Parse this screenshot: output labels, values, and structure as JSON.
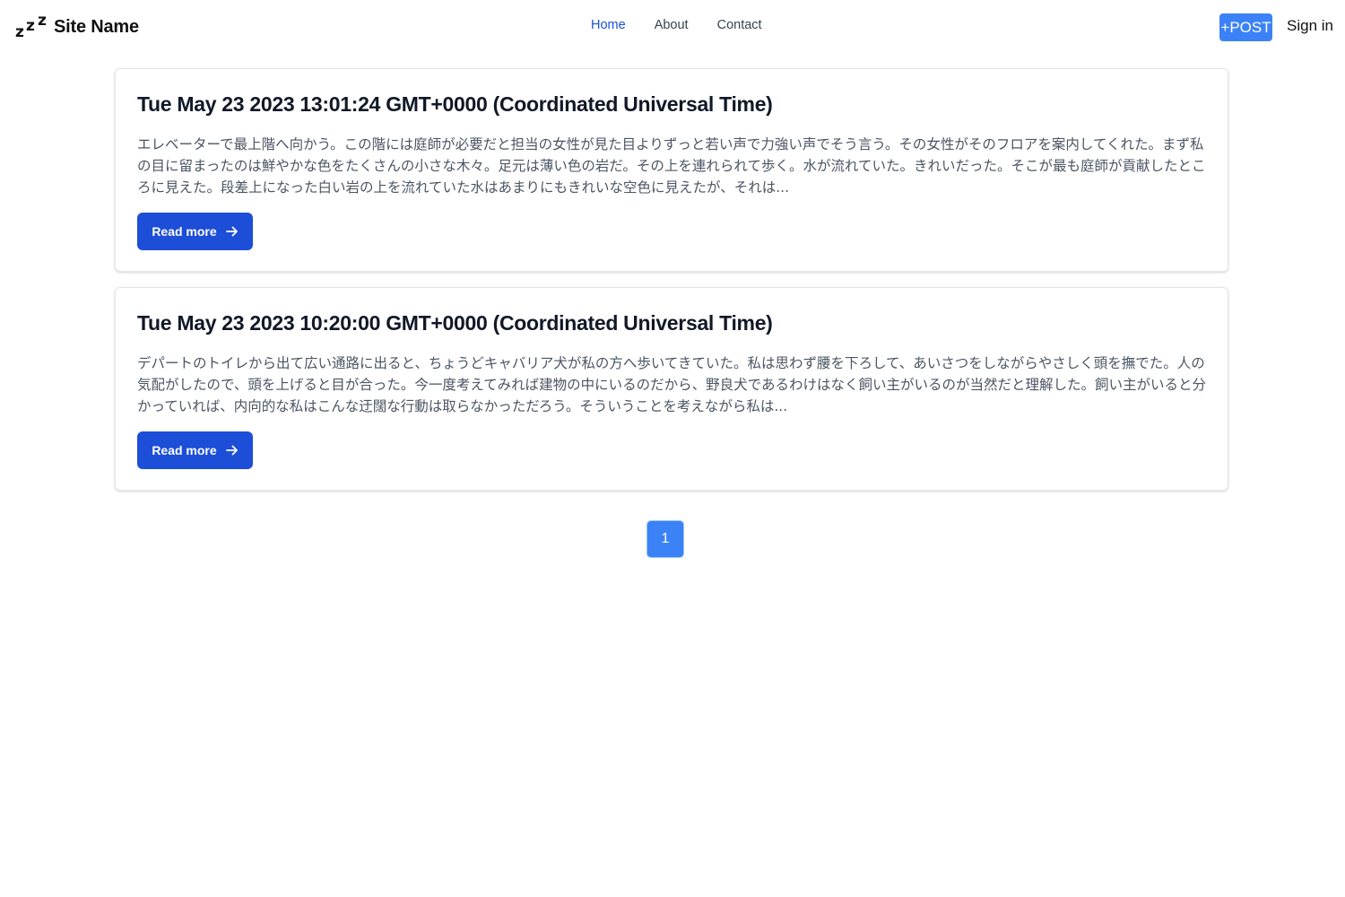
{
  "header": {
    "brand_name": "Site Name",
    "logo_letters": [
      "z",
      "z",
      "z"
    ],
    "nav": [
      {
        "label": "Home",
        "active": true
      },
      {
        "label": "About",
        "active": false
      },
      {
        "label": "Contact",
        "active": false
      }
    ],
    "post_label": "+POST",
    "signin_label": "Sign in"
  },
  "posts": [
    {
      "title": "Tue May 23 2023 13:01:24 GMT+0000 (Coordinated Universal Time)",
      "excerpt": "エレベーターで最上階へ向かう。この階には庭師が必要だと担当の女性が見た目よりずっと若い声で力強い声でそう言う。その女性がそのフロアを案内してくれた。まず私の目に留まったのは鮮やかな色をたくさんの小さな木々。足元は薄い色の岩だ。その上を連れられて歩く。水が流れていた。きれいだった。そこが最も庭師が貢献したところに見えた。段差上になった白い岩の上を流れていた水はあまりにもきれいな空色に見えたが、それは...",
      "read_more_label": "Read more"
    },
    {
      "title": "Tue May 23 2023 10:20:00 GMT+0000 (Coordinated Universal Time)",
      "excerpt": "デパートのトイレから出て広い通路に出ると、ちょうどキャバリア犬が私の方へ歩いてきていた。私は思わず腰を下ろして、あいさつをしながらやさしく頭を撫でた。人の気配がしたので、頭を上げると目が合った。今一度考えてみれば建物の中にいるのだから、野良犬であるわけはなく飼い主がいるのが当然だと理解した。飼い主がいると分かっていれば、内向的な私はこんな迂闊な行動は取らなかっただろう。そういうことを考えながら私は...",
      "read_more_label": "Read more"
    }
  ],
  "pagination": {
    "current_page": "1"
  },
  "colors": {
    "primary": "#1d4ed8",
    "accent": "#3b82f6",
    "text": "#111827",
    "muted_text": "#4b5563"
  }
}
